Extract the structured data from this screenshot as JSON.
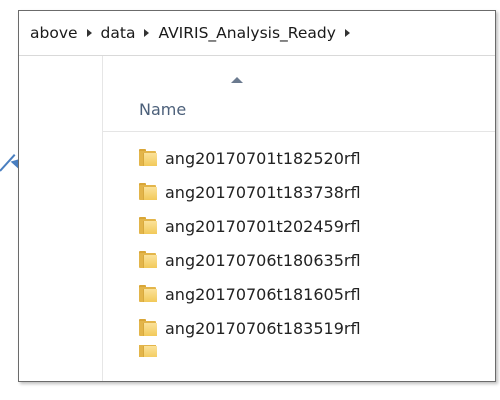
{
  "breadcrumb": {
    "items": [
      "above",
      "data",
      "AVIRIS_Analysis_Ready"
    ]
  },
  "file_list": {
    "column_header": "Name",
    "sort": "ascending",
    "items": [
      {
        "name": "ang20170701t182520rfl",
        "icon": "folder-icon"
      },
      {
        "name": "ang20170701t183738rfl",
        "icon": "folder-icon"
      },
      {
        "name": "ang20170701t202459rfl",
        "icon": "folder-icon"
      },
      {
        "name": "ang20170706t180635rfl",
        "icon": "folder-icon"
      },
      {
        "name": "ang20170706t181605rfl",
        "icon": "folder-icon"
      },
      {
        "name": "ang20170706t183519rfl",
        "icon": "folder-icon"
      }
    ]
  },
  "colors": {
    "folder": "#e3b54a",
    "header_text": "#4c607a",
    "annotation_arrow": "#4a7fc0"
  }
}
